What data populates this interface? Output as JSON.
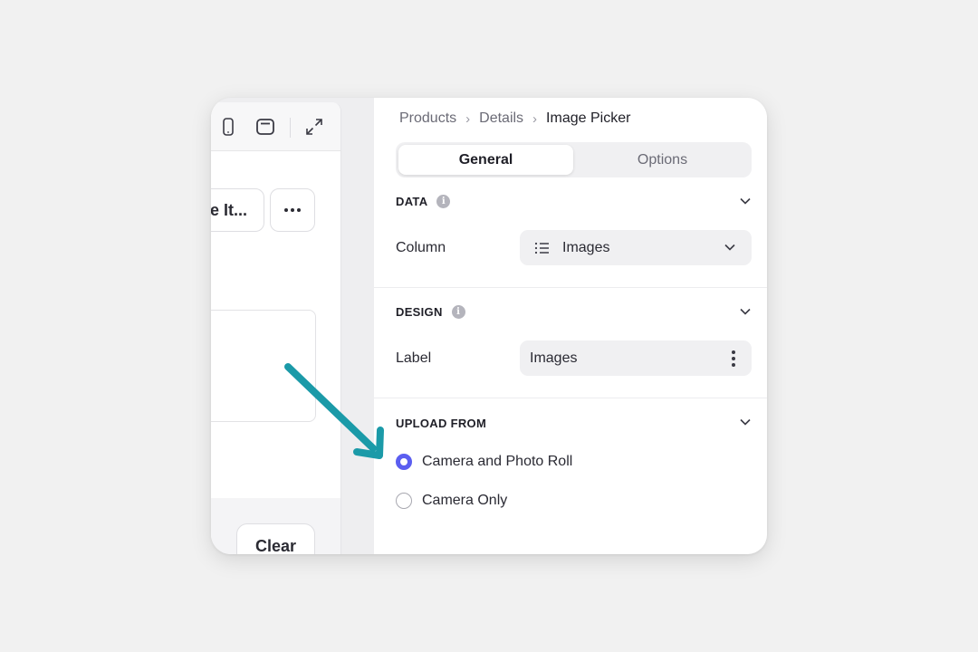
{
  "preview": {
    "truncated_button": "e It...",
    "more_label": "•••",
    "clear_label": "Clear"
  },
  "breadcrumb": [
    "Products",
    "Details",
    "Image Picker"
  ],
  "breadcrumb_sep": "›",
  "tabs": [
    {
      "label": "General",
      "active": true
    },
    {
      "label": "Options",
      "active": false
    }
  ],
  "sections": {
    "data": {
      "title": "DATA",
      "column_label": "Column",
      "column_value": "Images"
    },
    "design": {
      "title": "DESIGN",
      "label_label": "Label",
      "label_value": "Images"
    },
    "upload": {
      "title": "UPLOAD FROM",
      "options": [
        {
          "label": "Camera and Photo Roll",
          "selected": true
        },
        {
          "label": "Camera Only",
          "selected": false
        }
      ]
    }
  },
  "colors": {
    "accent_radio": "#5b5ef0",
    "arrow": "#1b9aa8"
  }
}
